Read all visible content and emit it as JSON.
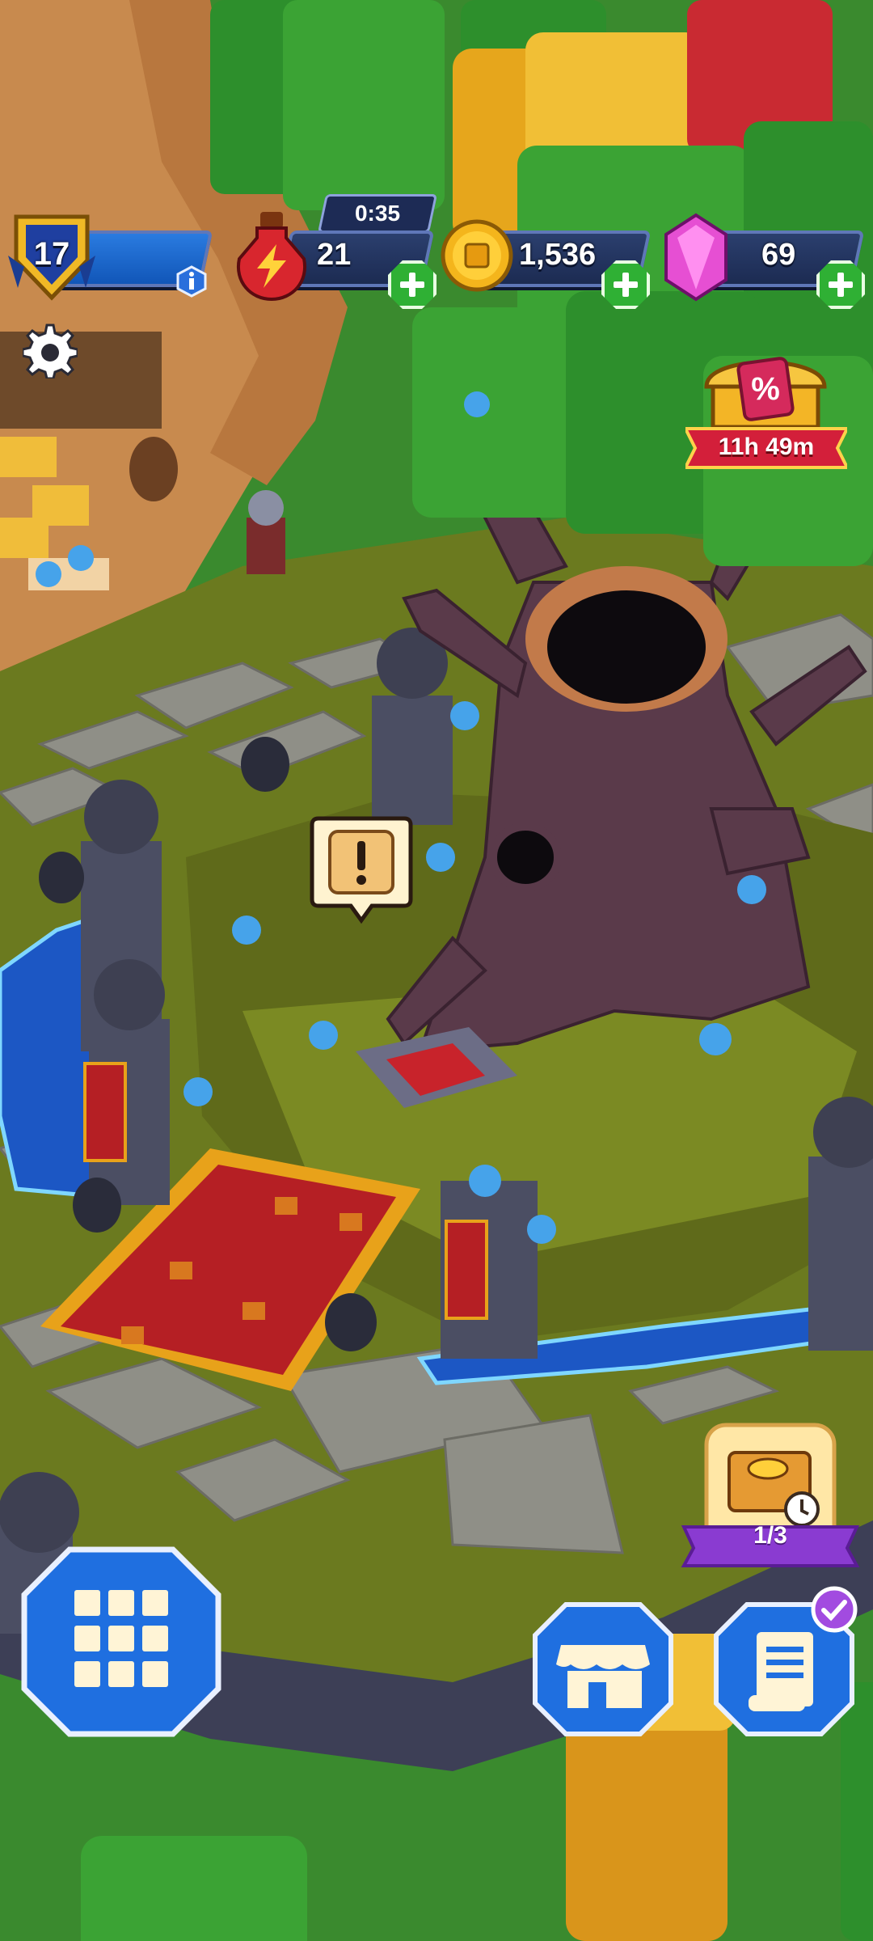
{
  "hud": {
    "level": "17",
    "energy": "21",
    "energy_timer": "0:35",
    "coins": "1,536",
    "gems": "69"
  },
  "offer": {
    "timer": "11h 49m"
  },
  "chest": {
    "progress": "1/3"
  },
  "icons": {
    "level": "shield-badge",
    "info": "info",
    "energy": "potion-lightning",
    "coins": "gold-coin",
    "gems": "pink-gem",
    "settings": "gear",
    "offer": "percent-chest",
    "quest": "scroll-exclamation",
    "chest_card": "treasure-map-clock",
    "menu": "grid",
    "shop": "market-stall",
    "quests": "scroll-list",
    "checkmark": "check"
  },
  "colors": {
    "hud_panel": "#1c2b52",
    "plus_button": "#2fb034",
    "action_button": "#1f6fe0",
    "offer_banner": "#d31f3a",
    "chest_ribbon": "#8a3bd1",
    "badge_check": "#a24be0"
  }
}
